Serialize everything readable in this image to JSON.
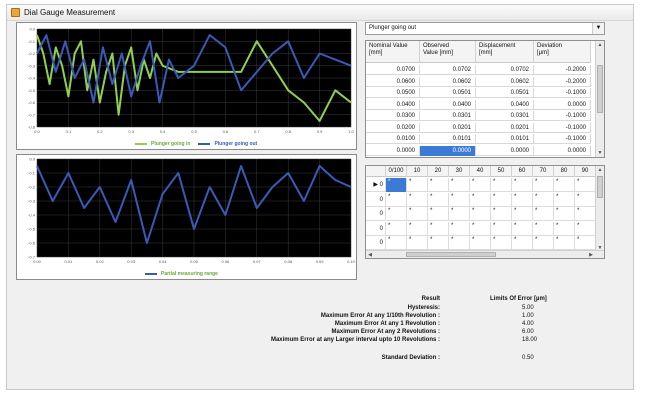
{
  "window": {
    "title": "Dial Gauge Measurement"
  },
  "colors": {
    "green": "#8fd14f",
    "blue": "#3a5ab8",
    "plot_bg": "#000000",
    "grid": "#3a3a3a",
    "selection": "#3b7bd5"
  },
  "top_chart": {
    "legend": [
      "Plunger going in",
      "Plunger going out"
    ],
    "y_ticks": [
      "0.0",
      "-0.1",
      "-0.2",
      "-0.3",
      "-0.4",
      "-0.5",
      "-0.6",
      "-0.7",
      "-0.8"
    ],
    "x_ticks": [
      "0.0",
      "0.1",
      "0.2",
      "0.3",
      "0.4",
      "0.5",
      "0.6",
      "0.7",
      "0.8",
      "0.9",
      "1.0"
    ]
  },
  "bottom_chart": {
    "legend": [
      "Partial measuring range"
    ],
    "y_ticks": [
      "0.0",
      "-0.1",
      "-0.2",
      "-0.3",
      "-0.4",
      "-0.5",
      "-0.6",
      "-0.7"
    ],
    "x_ticks": [
      "0.00",
      "0.01",
      "0.02",
      "0.03",
      "0.04",
      "0.05",
      "0.06",
      "0.07",
      "0.08",
      "0.09",
      "0.10"
    ]
  },
  "chart_data": [
    {
      "type": "line",
      "series": [
        {
          "name": "Plunger going in",
          "x": [
            0.0,
            0.02,
            0.04,
            0.06,
            0.08,
            0.1,
            0.12,
            0.14,
            0.16,
            0.18,
            0.2,
            0.22,
            0.24,
            0.26,
            0.28,
            0.3,
            0.32,
            0.34,
            0.36,
            0.38,
            0.4,
            0.45,
            0.5,
            0.55,
            0.6,
            0.65,
            0.7,
            0.75,
            0.8,
            0.85,
            0.9,
            0.95,
            1.0
          ],
          "values": [
            -0.05,
            -0.2,
            -0.45,
            -0.15,
            -0.3,
            -0.55,
            -0.2,
            -0.1,
            -0.5,
            -0.25,
            -0.6,
            -0.35,
            -0.2,
            -0.7,
            -0.3,
            -0.15,
            -0.5,
            -0.25,
            -0.4,
            -0.2,
            -0.3,
            -0.35,
            -0.35,
            -0.35,
            -0.35,
            -0.35,
            -0.1,
            -0.3,
            -0.5,
            -0.6,
            -0.75,
            -0.5,
            -0.6
          ]
        },
        {
          "name": "Plunger going out",
          "x": [
            0.0,
            0.03,
            0.06,
            0.09,
            0.12,
            0.15,
            0.18,
            0.21,
            0.24,
            0.27,
            0.3,
            0.33,
            0.36,
            0.39,
            0.42,
            0.45,
            0.5,
            0.55,
            0.6,
            0.65,
            0.7,
            0.75,
            0.8,
            0.85,
            0.9,
            0.95,
            1.0
          ],
          "values": [
            -0.2,
            -0.05,
            -0.35,
            -0.1,
            -0.4,
            -0.25,
            -0.6,
            -0.15,
            -0.45,
            -0.2,
            -0.55,
            -0.3,
            -0.1,
            -0.6,
            -0.25,
            -0.4,
            -0.3,
            -0.05,
            -0.15,
            -0.5,
            -0.35,
            -0.2,
            -0.1,
            -0.4,
            -0.2,
            -0.25,
            -0.3
          ]
        }
      ],
      "ylim": [
        -0.8,
        0.0
      ],
      "xlim": [
        0.0,
        1.0
      ],
      "grid": true,
      "legend": "bottom"
    },
    {
      "type": "line",
      "series": [
        {
          "name": "Partial measuring range",
          "x": [
            0.0,
            0.005,
            0.01,
            0.015,
            0.02,
            0.025,
            0.03,
            0.035,
            0.04,
            0.045,
            0.05,
            0.055,
            0.06,
            0.065,
            0.07,
            0.075,
            0.08,
            0.085,
            0.09,
            0.095,
            0.1
          ],
          "values": [
            -0.05,
            -0.3,
            -0.1,
            -0.35,
            -0.2,
            -0.45,
            -0.15,
            -0.6,
            -0.25,
            -0.1,
            -0.5,
            -0.2,
            -0.4,
            -0.05,
            -0.35,
            -0.2,
            -0.1,
            -0.3,
            -0.05,
            -0.15,
            -0.2
          ]
        }
      ],
      "ylim": [
        -0.7,
        0.0
      ],
      "xlim": [
        0.0,
        0.1
      ],
      "grid": true,
      "legend": "bottom"
    }
  ],
  "combo": {
    "value": "Plunger going out"
  },
  "data_grid": {
    "headers": [
      [
        "Nominal Value",
        "[mm]"
      ],
      [
        "Observed",
        "Value [mm]"
      ],
      [
        "Displacement",
        "[mm]"
      ],
      [
        "Deviation",
        "[µm]"
      ]
    ],
    "rows": [
      [
        "0.0700",
        "0.0702",
        "0.0702",
        "-0.2000"
      ],
      [
        "0.0600",
        "0.0602",
        "0.0602",
        "-0.2000"
      ],
      [
        "0.0500",
        "0.0501",
        "0.0501",
        "-0.1000"
      ],
      [
        "0.0400",
        "0.0400",
        "0.0400",
        "0.0000"
      ],
      [
        "0.0300",
        "0.0301",
        "0.0301",
        "-0.1000"
      ],
      [
        "0.0200",
        "0.0201",
        "0.0201",
        "-0.1000"
      ],
      [
        "0.0100",
        "0.0101",
        "0.0101",
        "-0.1000"
      ],
      [
        "0.0000",
        "0.0000",
        "0.0000",
        "0.0000"
      ]
    ]
  },
  "rev_grid": {
    "headers": [
      "",
      "0/100",
      "10",
      "20",
      "30",
      "40",
      "50",
      "60",
      "70",
      "80",
      "90"
    ],
    "row_labels": [
      "0",
      "0",
      "0",
      "0",
      "0"
    ],
    "cell": "*"
  },
  "results": {
    "header_label": "Result",
    "header_value": "Limits Of Error  [µm]",
    "lines": [
      {
        "label": "Hysteresis:",
        "value": "5.00"
      },
      {
        "label": "Maximum Error At any 1/10th Revolution :",
        "value": "1.00"
      },
      {
        "label": "Maximum Error At any 1 Revolution :",
        "value": "4.00"
      },
      {
        "label": "Maximum Error At any 2 Revolutions :",
        "value": "6.00"
      },
      {
        "label": "Maximum Error at any Larger interval upto 10 Revolutions :",
        "value": "18.00"
      },
      {
        "label": "Standard Deviation :",
        "value": "0.50"
      }
    ]
  }
}
